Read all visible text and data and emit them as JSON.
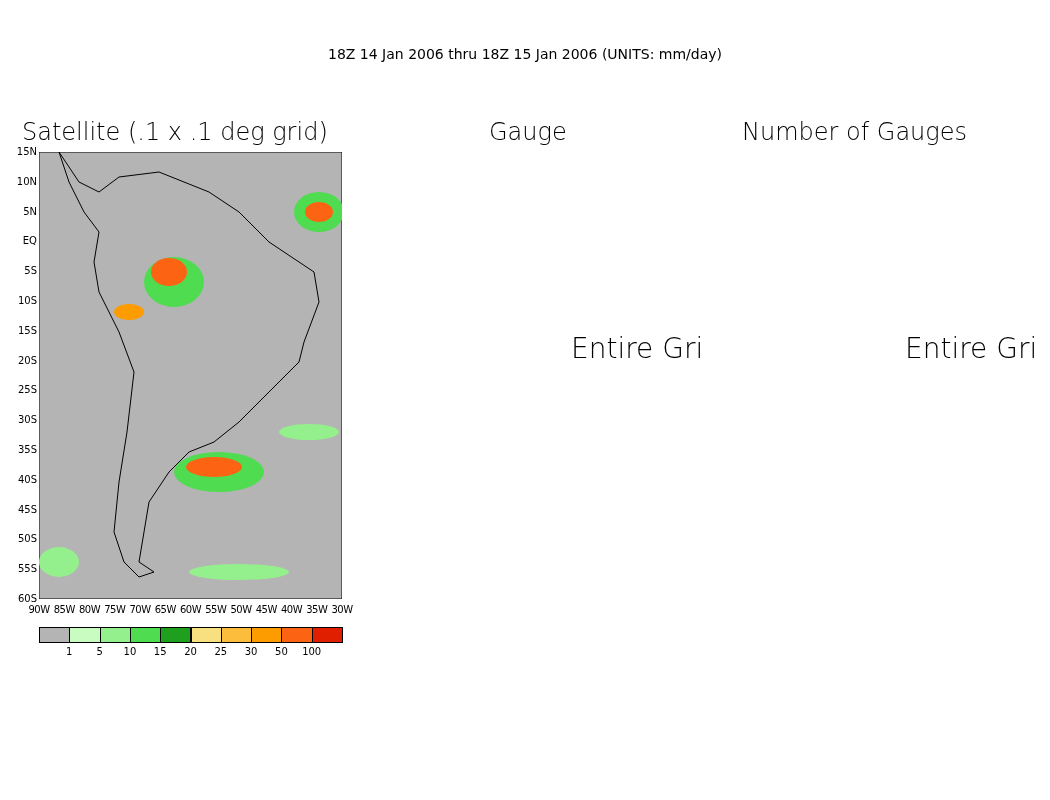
{
  "title": "18Z 14 Jan 2006 thru 18Z 15 Jan 2006 (UNITS: mm/day)",
  "panels": [
    {
      "heading": "Satellite (.1 x .1 deg grid)",
      "kind": "map",
      "lat_labels": [
        "15N",
        "10N",
        "5N",
        "EQ",
        "5S",
        "10S",
        "15S",
        "20S",
        "25S",
        "30S",
        "35S",
        "40S",
        "45S",
        "50S",
        "55S",
        "60S"
      ],
      "lon_labels": [
        "90W",
        "85W",
        "80W",
        "75W",
        "70W",
        "65W",
        "60W",
        "55W",
        "50W",
        "45W",
        "40W",
        "35W",
        "30W"
      ]
    },
    {
      "heading": "Gauge",
      "kind": "message",
      "message": "Entire Gri"
    },
    {
      "heading": "Number of Gauges",
      "kind": "message",
      "message": "Entire Gri"
    }
  ],
  "colorbar": {
    "items": [
      {
        "color": "#b4b4b4"
      },
      {
        "color": "#c8fcc0"
      },
      {
        "color": "#94f08c"
      },
      {
        "color": "#50dc50"
      },
      {
        "color": "#1ea01e"
      },
      {
        "color": "#f8e080"
      },
      {
        "color": "#fcbc3c"
      },
      {
        "color": "#fc9c00"
      },
      {
        "color": "#fc6414"
      },
      {
        "color": "#e01e00"
      }
    ],
    "labels": [
      "1",
      "5",
      "10",
      "15",
      "20",
      "25",
      "30",
      "50",
      "100"
    ]
  }
}
